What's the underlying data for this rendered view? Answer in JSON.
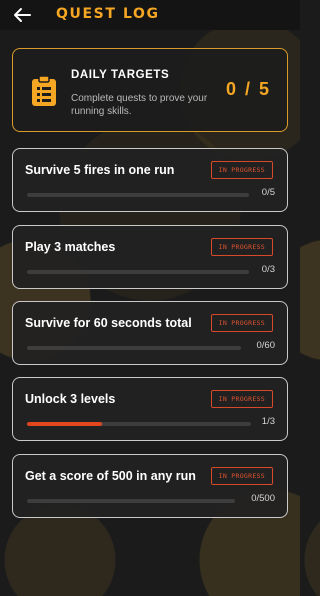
{
  "header": {
    "title": "QUEST LOG",
    "back_icon": "arrow-left-icon"
  },
  "colors": {
    "accent": "#f5a623",
    "status": "#e0522f",
    "bar_fill": "#e2461f"
  },
  "daily": {
    "icon": "clipboard-icon",
    "title": "DAILY TARGETS",
    "description": "Complete quests to prove your running skills.",
    "progress": "0 / 5"
  },
  "quests": [
    {
      "name": "Survive 5 fires in one run",
      "status": "IN PROGRESS",
      "count": "0/5",
      "progress": 0
    },
    {
      "name": "Play 3 matches",
      "status": "IN PROGRESS",
      "count": "0/3",
      "progress": 0
    },
    {
      "name": "Survive for 60 seconds total",
      "status": "IN PROGRESS",
      "count": "0/60",
      "progress": 0
    },
    {
      "name": "Unlock 3 levels",
      "status": "IN PROGRESS",
      "count": "1/3",
      "progress": 0.333
    },
    {
      "name": "Get a score of 500 in any run",
      "status": "IN PROGRESS",
      "count": "0/500",
      "progress": 0
    }
  ]
}
